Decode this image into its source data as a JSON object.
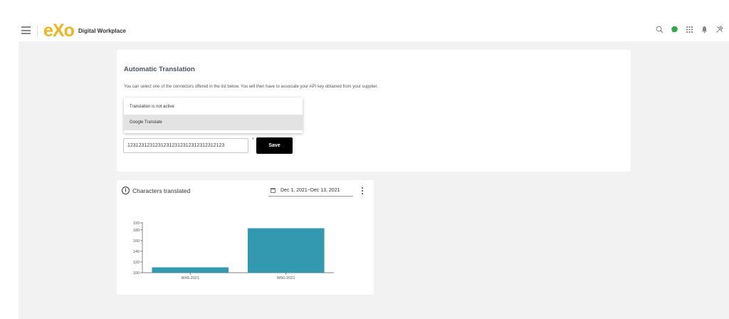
{
  "topbar": {
    "logo_text": "eXo",
    "app_title": "Digital Workplace",
    "icons": [
      "search-icon",
      "chat-icon",
      "apps-grid-icon",
      "notifications-bell-icon",
      "admin-tools-icon"
    ],
    "chat_color": "#2eaa4a"
  },
  "translation": {
    "title": "Automatic Translation",
    "description": "You can select one of the connectors offered in the list below. You will then have to associate your API key obtained from your supplier.",
    "options": [
      "Translation is not active",
      "Google Translate"
    ],
    "selected_option": "Google Translate",
    "api_key_value": "12312312312312312312312312312312123",
    "required_mark": "*",
    "save_label": "Save"
  },
  "chart_card": {
    "title": "Characters translated",
    "date_range": "Dec 1, 2021~Dec 13, 2021"
  },
  "chart_data": {
    "type": "bar",
    "categories": [
      "W49-2021",
      "W50-2021"
    ],
    "values": [
      110,
      183
    ],
    "ylim": [
      100,
      193
    ],
    "yticks": [
      100,
      120,
      140,
      160,
      180,
      193
    ],
    "bar_color": "#3399b1"
  }
}
